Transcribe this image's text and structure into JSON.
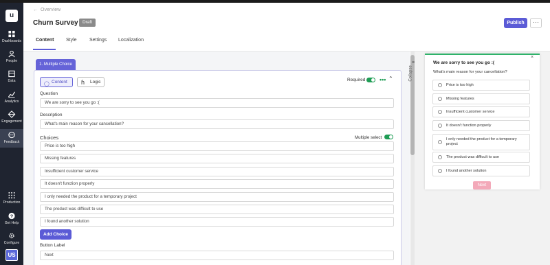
{
  "app": {
    "logo_text": "u"
  },
  "sidebar": {
    "items": [
      {
        "label": "Dashboards",
        "icon": "grid-icon"
      },
      {
        "label": "People",
        "icon": "people-icon"
      },
      {
        "label": "Data",
        "icon": "database-icon"
      },
      {
        "label": "Analytics",
        "icon": "chart-icon"
      },
      {
        "label": "Engagement",
        "icon": "diamond-icon"
      },
      {
        "label": "Feedback",
        "icon": "chat-icon",
        "active": true
      }
    ],
    "bottom_items": [
      {
        "label": "Production",
        "icon": "apps-grid-icon"
      },
      {
        "label": "Get Help",
        "icon": "help-icon"
      },
      {
        "label": "Configure",
        "icon": "gear-icon"
      }
    ],
    "avatar_initials": "US"
  },
  "header": {
    "breadcrumb": "Overview",
    "title": "Churn Survey",
    "status_badge": "Draft",
    "publish_label": "Publish",
    "more_label": "···"
  },
  "tabs": [
    {
      "label": "Content",
      "active": true
    },
    {
      "label": "Style"
    },
    {
      "label": "Settings"
    },
    {
      "label": "Localization"
    }
  ],
  "editor": {
    "question_pill": "1. Multiple Choice",
    "content_btn": "Content",
    "logic_btn": "Logic",
    "required_label": "Required",
    "required_on": true,
    "question_label": "Question",
    "question_value": "We are sorry to see you go :(",
    "description_label": "Description",
    "description_value": "What's main reason for your cancellation?",
    "choices_label": "Choices",
    "multiple_select_label": "Multiple select",
    "multiple_select_on": true,
    "choices": [
      "Price is too high",
      "Missing features",
      "Insufficient customer service",
      "It doesn't function properly",
      "I only needed the product for a temporary project",
      "The product was difficult to use",
      "I found another solution"
    ],
    "add_choice_label": "Add Choice",
    "button_label_title": "Button Label",
    "button_label_value": "Next"
  },
  "collapse_label": "Collapse",
  "preview": {
    "title": "We are sorry to see you go :(",
    "subtitle": "What's main reason for your cancellation?",
    "options": [
      "Price is too high",
      "Missing features",
      "Insufficient customer service",
      "It doesn't function properly",
      "I only needed the product for a temporary project",
      "The product was difficult to use",
      "I found another solution"
    ],
    "next_label": "Next",
    "close_label": "×"
  },
  "colors": {
    "accent": "#5b5bd6",
    "sidebar_bg": "#1f2430",
    "toggle_on": "#1f9d55",
    "preview_top_border": "#2fb36a",
    "next_button": "#f3a9b9"
  }
}
